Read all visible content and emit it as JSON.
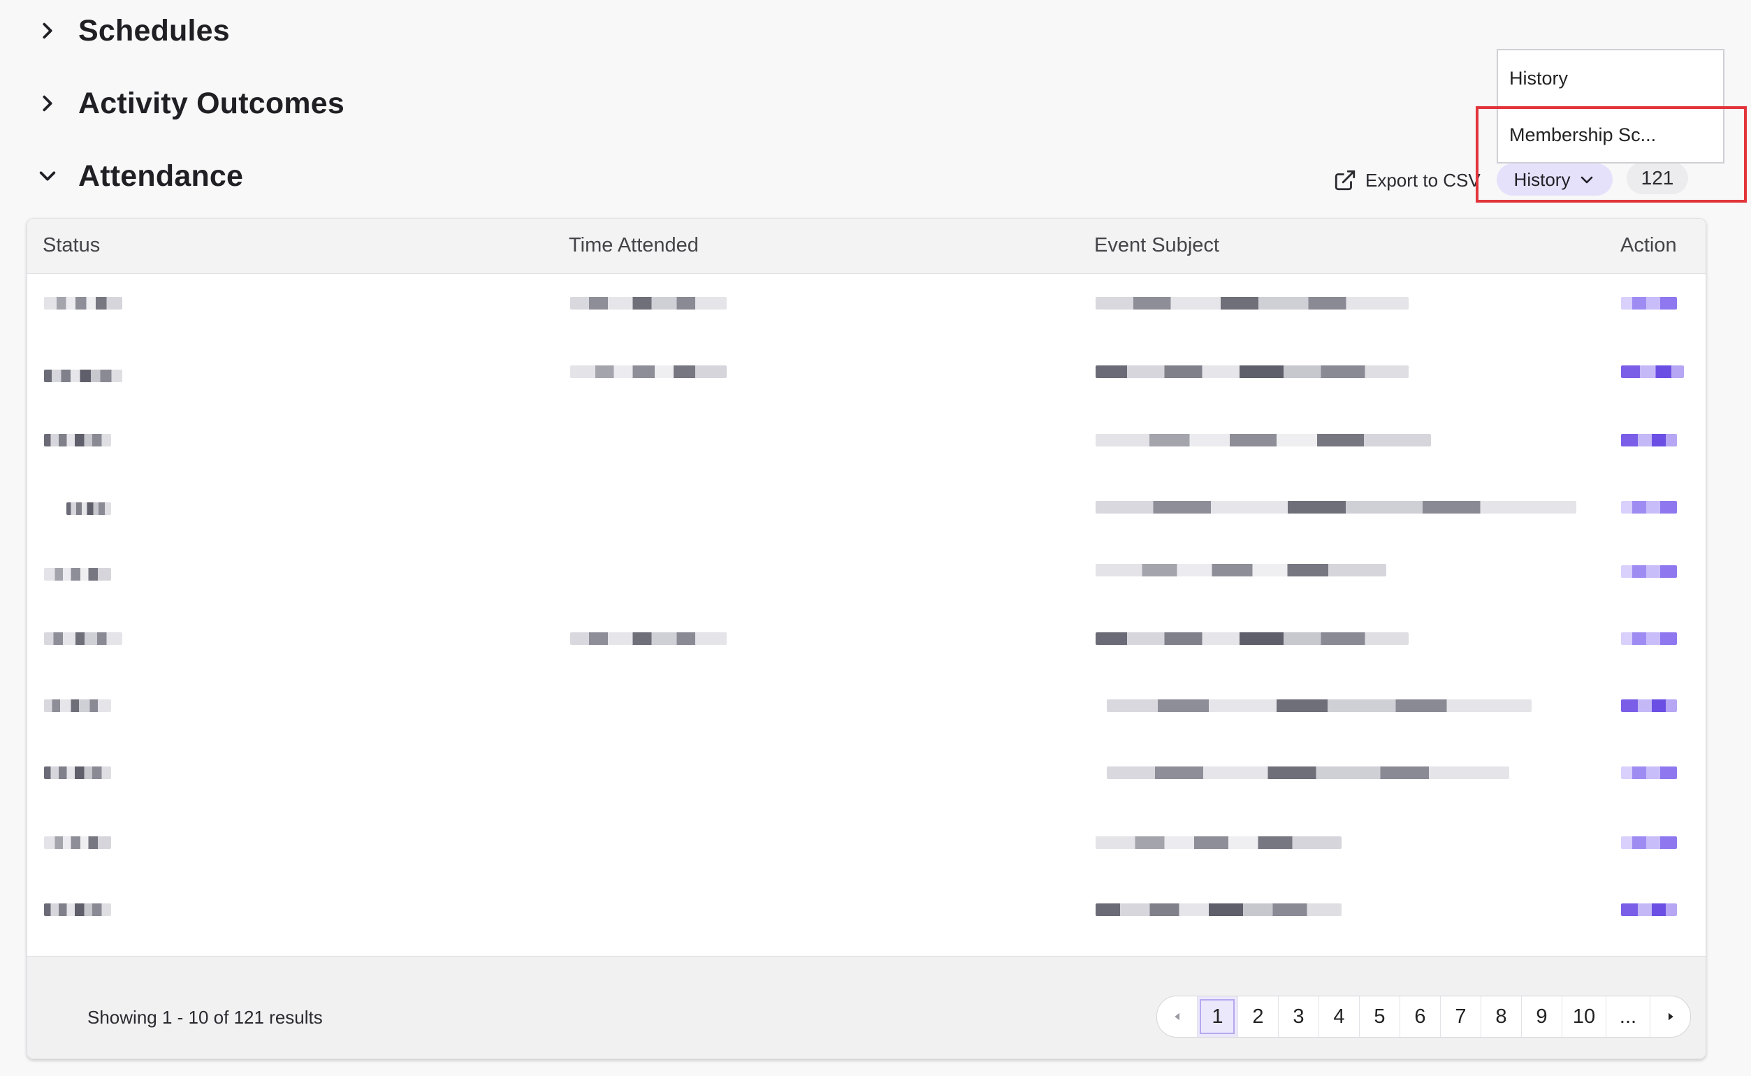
{
  "sections": {
    "schedules": "Schedules",
    "activity_outcomes": "Activity Outcomes",
    "attendance": "Attendance"
  },
  "toolbar": {
    "export_label": "Export to CSV",
    "history_selected": "History",
    "count": "121"
  },
  "dropdown": {
    "options": [
      "History",
      "Membership Sc..."
    ]
  },
  "table": {
    "columns": [
      "Status",
      "Time Attended",
      "Event Subject",
      "Action"
    ]
  },
  "footer": {
    "results_text": "Showing 1 - 10 of 121 results",
    "pages": [
      "1",
      "2",
      "3",
      "4",
      "5",
      "6",
      "7",
      "8",
      "9",
      "10",
      "..."
    ],
    "current_page": "1"
  },
  "icons": {
    "chevron_right": "chevron-right-icon",
    "chevron_down": "chevron-down-icon",
    "external_link": "external-link-icon",
    "prev": "caret-left-icon",
    "next": "caret-right-icon"
  },
  "colors": {
    "accent": "#e6e1fb",
    "highlight_border": "#e2353b"
  }
}
